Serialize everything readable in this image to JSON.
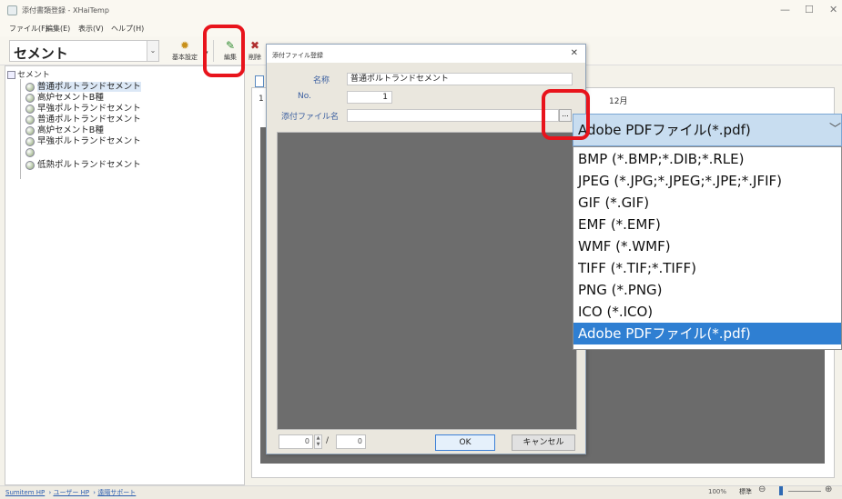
{
  "window": {
    "title": "添付書類登録 - XHaiTemp",
    "controls": [
      "—",
      "☐",
      "✕"
    ]
  },
  "menubar": [
    "ファイル(F)",
    "編集(E)",
    "表示(V)",
    "ヘルプ(H)"
  ],
  "toolbar": {
    "category_combo": "セメント",
    "buttons": [
      {
        "label": "基本設定",
        "icon": "gear-icon"
      },
      {
        "label": "編集",
        "icon": "pencil-icon"
      },
      {
        "label": "削除",
        "icon": "delete-icon"
      }
    ]
  },
  "tree": {
    "root": "セメント",
    "items": [
      "普通ポルトランドセメント",
      "高炉セメントB種",
      "早強ポルトランドセメント",
      "普通ポルトランドセメント",
      "高炉セメントB種",
      "早強ポルトランドセメント",
      "",
      "低熱ポルトランドセメント"
    ],
    "selected_index": 0
  },
  "main": {
    "row_label": "1",
    "month_label": "12月"
  },
  "dialog": {
    "title": "添付ファイル登録",
    "close": "✕",
    "name_label": "名称",
    "name_value": "普通ポルトランドセメント",
    "no_label": "No.",
    "no_value": "1",
    "file_label": "添付ファイル名",
    "file_value": "",
    "browse": "...",
    "pager_current": "0",
    "pager_slash": "/",
    "pager_total": "0",
    "ok": "OK",
    "cancel": "キャンセル"
  },
  "filetype": {
    "selected": "Adobe PDFファイル(*.pdf)",
    "options": [
      "BMP (*.BMP;*.DIB;*.RLE)",
      "JPEG (*.JPG;*.JPEG;*.JPE;*.JFIF)",
      "GIF (*.GIF)",
      "EMF (*.EMF)",
      "WMF (*.WMF)",
      "TIFF (*.TIF;*.TIFF)",
      "PNG (*.PNG)",
      "ICO (*.ICO)",
      "Adobe PDFファイル(*.pdf)"
    ],
    "highlighted_index": 8
  },
  "statusbar": {
    "links": [
      "Sumitem HP",
      "ユーザー HP",
      "遠隔サポート"
    ],
    "zoom": "100%",
    "zoom_mode": "標準",
    "zoom_out": "⊖",
    "zoom_in": "⊕"
  },
  "colors": {
    "highlight": "#e8141c",
    "selection": "#2f7fd2",
    "dropdown_header": "#c8ddf0",
    "preview_gray": "#6d6d6d"
  }
}
